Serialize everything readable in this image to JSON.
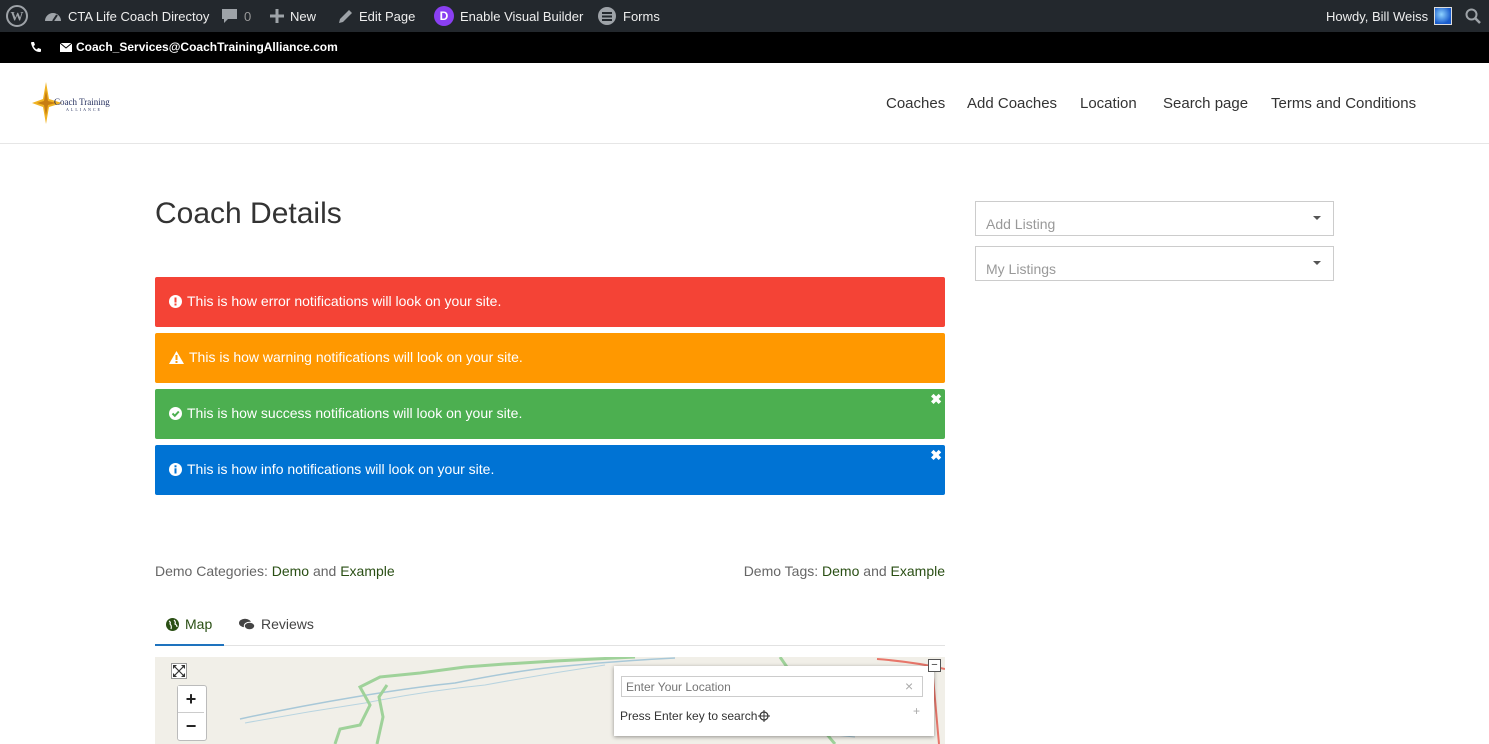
{
  "admin_bar": {
    "site_name": "CTA Life Coach Directoy",
    "comments_count": "0",
    "new_label": "New",
    "edit_page_label": "Edit Page",
    "visual_builder_label": "Enable Visual Builder",
    "divi_letter": "D",
    "forms_label": "Forms",
    "howdy": "Howdy, Bill Weiss"
  },
  "top_bar": {
    "email": "Coach_Services@CoachTrainingAlliance.com"
  },
  "logo": {
    "line1": "Coach Training",
    "line2": "ALLIANCE"
  },
  "nav": [
    "Coaches",
    "Add Coaches",
    "Location",
    "Search page",
    "Terms and Conditions"
  ],
  "page_title": "Coach Details",
  "alerts": {
    "error": "This is how error notifications will look on your site.",
    "warning": "This is how warning notifications will look on your site.",
    "success": "This is how success notifications will look on your site.",
    "info": "This is how info notifications will look on your site.",
    "close_symbol": "✖"
  },
  "sidebar": {
    "add_listing": "Add Listing",
    "my_listings": "My Listings"
  },
  "meta": {
    "categories_label": "Demo Categories:",
    "tags_label": "Demo Tags:",
    "link1": "Demo",
    "conj": "and",
    "link2": "Example"
  },
  "tabs": {
    "map": "Map",
    "reviews": "Reviews"
  },
  "map": {
    "zoom_in": "+",
    "zoom_out": "−",
    "location_placeholder": "Enter Your Location",
    "clear_symbol": "×",
    "hint": "Press Enter key to search",
    "collapse_symbol": "−",
    "expand_symbol": "+"
  },
  "colors": {
    "admin_bar": "#23282d",
    "error": "#f44336",
    "warning": "#ff9800",
    "success": "#4caf50",
    "info": "#0073d4",
    "link": "#2a4f14",
    "tab_active": "#1e73be"
  }
}
